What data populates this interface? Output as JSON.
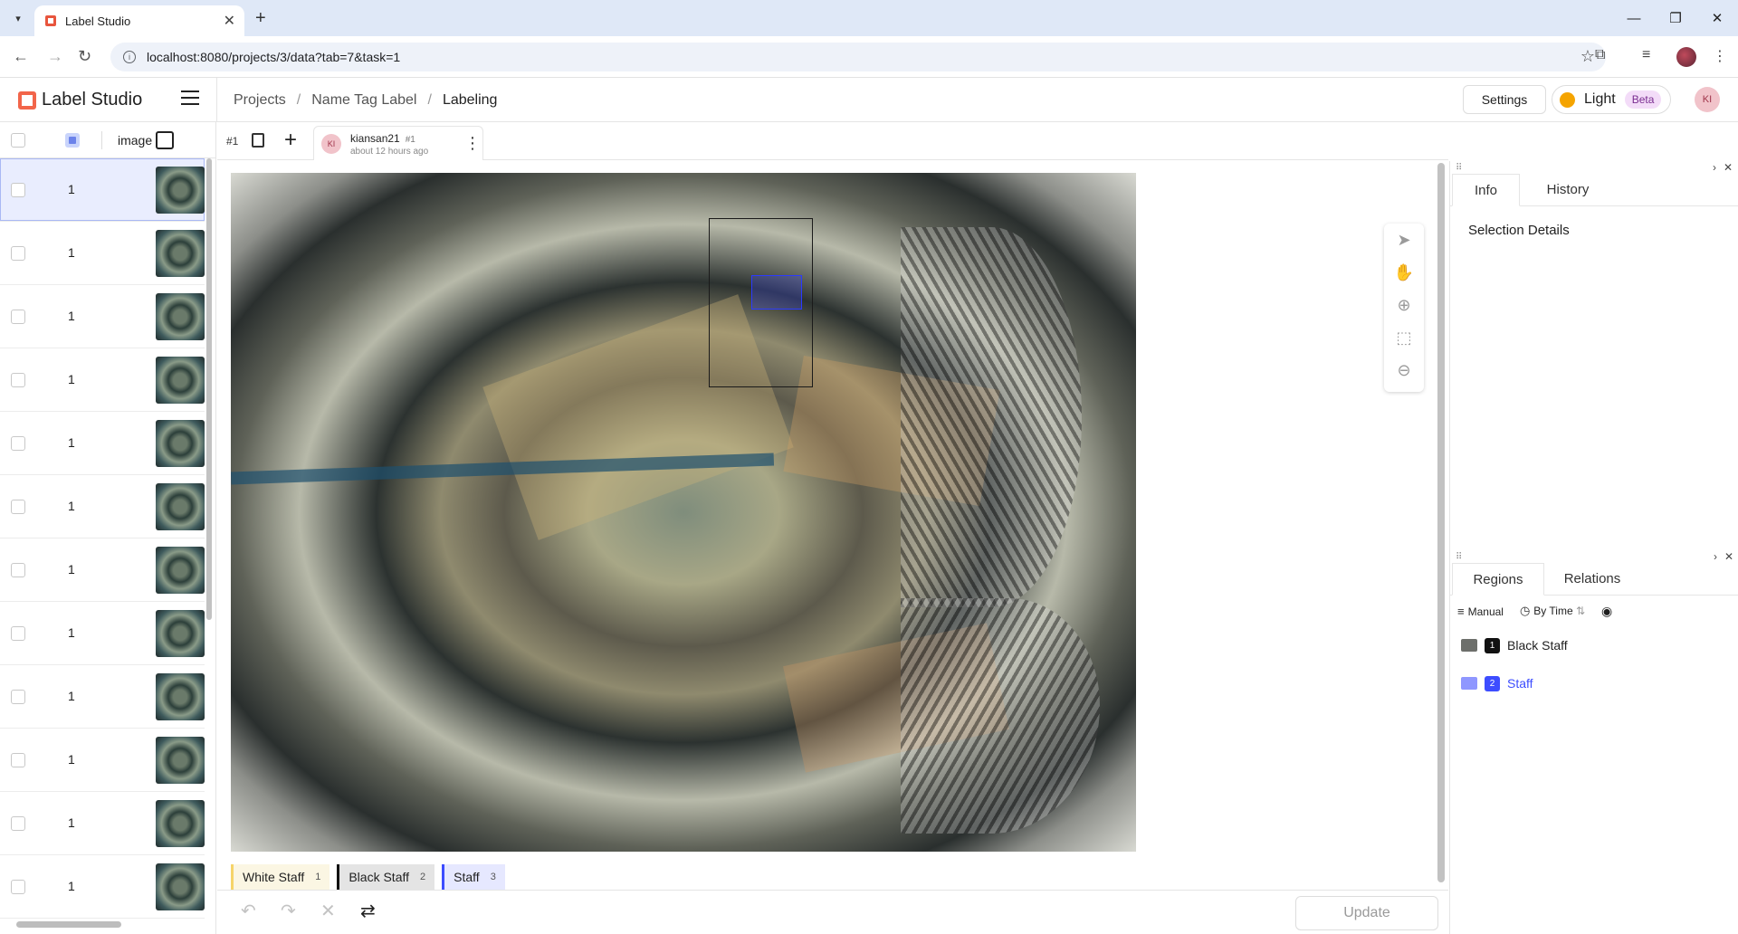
{
  "browser": {
    "tab_title": "Label Studio",
    "url": "localhost:8080/projects/3/data?tab=7&task=1"
  },
  "header": {
    "brand": "Label Studio",
    "breadcrumbs": [
      "Projects",
      "Name Tag Label",
      "Labeling"
    ],
    "settings_label": "Settings",
    "theme_label": "Light",
    "beta_label": "Beta",
    "user_initials": "KI"
  },
  "tasklist": {
    "column_label": "image",
    "rows": [
      "1",
      "1",
      "1",
      "1",
      "1",
      "1",
      "1",
      "1",
      "1",
      "1",
      "1",
      "1"
    ]
  },
  "annotation": {
    "task_id": "#1",
    "user": "kiansan21",
    "annotation_id": "#1",
    "time": "about 12 hours ago"
  },
  "labels": [
    {
      "name": "White Staff",
      "key": "1",
      "color": "#f5d46a"
    },
    {
      "name": "Black Staff",
      "key": "2",
      "color": "#111111"
    },
    {
      "name": "Staff",
      "key": "3",
      "color": "#3d4dff"
    }
  ],
  "update_label": "Update",
  "side": {
    "tabs": [
      "Info",
      "History"
    ],
    "selection_details": "Selection Details",
    "tabs2": [
      "Regions",
      "Relations"
    ],
    "sort_manual": "Manual",
    "sort_by_time": "By Time",
    "regions": [
      {
        "num": "1",
        "name": "Black Staff",
        "color": "#111111"
      },
      {
        "num": "2",
        "name": "Staff",
        "color": "#3d4dff"
      }
    ]
  },
  "icons": {
    "tools": [
      "select-icon",
      "hand-icon",
      "zoom-in-icon",
      "fit-icon",
      "zoom-out-icon"
    ]
  }
}
